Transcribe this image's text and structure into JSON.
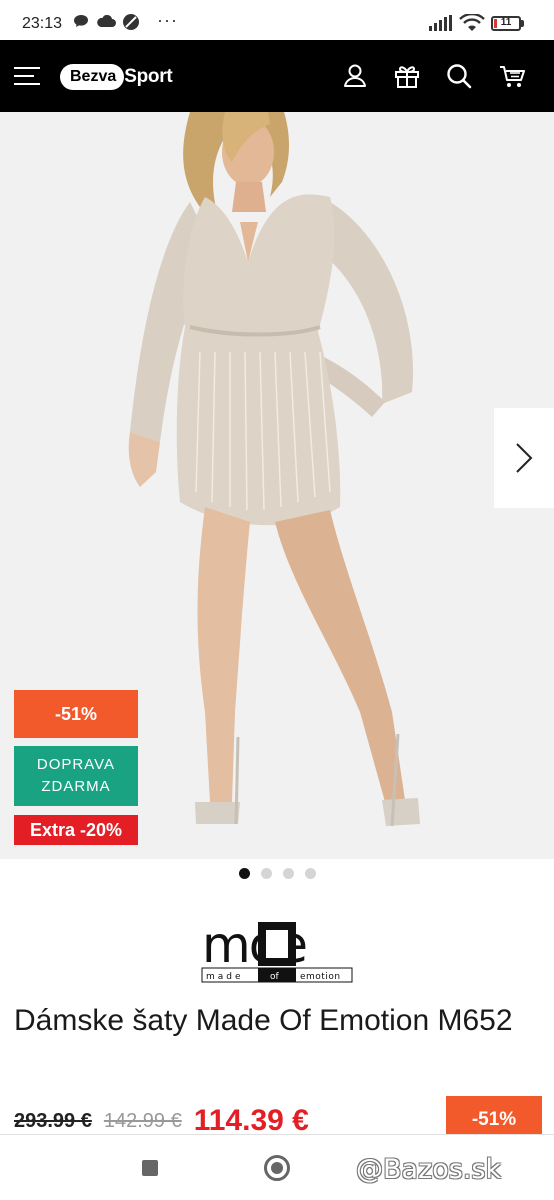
{
  "status_bar": {
    "time": "23:13",
    "dots": "···",
    "battery": "11",
    "icons": [
      "chat-bubble-icon",
      "cloud-icon",
      "no-sim-icon",
      "signal-icon",
      "wifi-icon",
      "battery-icon"
    ]
  },
  "header": {
    "logo_left": "Bezva",
    "logo_right": "Sport",
    "icons": [
      "menu-icon",
      "user-icon",
      "gift-icon",
      "search-icon",
      "cart-icon"
    ]
  },
  "gallery": {
    "badge_discount": "-51%",
    "badge_shipping_line1": "DOPRAVA",
    "badge_shipping_line2": "ZDARMA",
    "badge_extra": "Extra -20%",
    "slides": 4,
    "active_slide": 1
  },
  "brand": {
    "logo_text": "moe",
    "logo_sub_left": "made",
    "logo_sub_mid": "of",
    "logo_sub_right": "emotion"
  },
  "product": {
    "title": "Dámske šaty Made Of Emotion M652",
    "price_original": "293.99 €",
    "price_previous": "142.99 €",
    "price_current": "114.39 €",
    "discount_badge": "-51%"
  },
  "watermark": "@Bazos.sk",
  "colors": {
    "header_bg": "#000000",
    "discount_orange": "#f25a2b",
    "shipping_green": "#1aa383",
    "sale_red": "#e31e24"
  }
}
